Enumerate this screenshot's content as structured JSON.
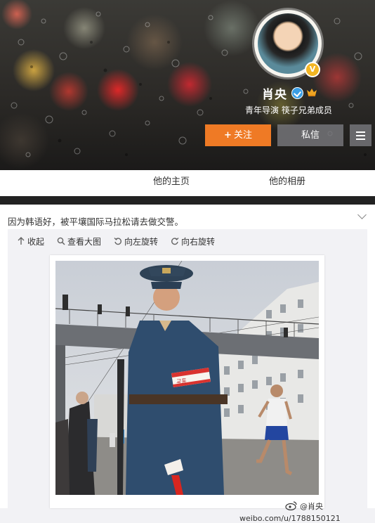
{
  "profile": {
    "name": "肖央",
    "description": "青年导演 筷子兄弟成员",
    "vip_badge": "V",
    "follow_label": "关注",
    "follow_plus": "+",
    "message_label": "私信"
  },
  "tabs": [
    {
      "label": "他的主页"
    },
    {
      "label": "他的相册"
    }
  ],
  "post": {
    "text": "因为韩语好，被平壤国际马拉松请去做交警。",
    "toolbar": {
      "collapse": "收起",
      "view_large": "查看大图",
      "rotate_left": "向左旋转",
      "rotate_right": "向右旋转"
    },
    "photo": {
      "armband_text": "교통",
      "watermark_url": "weibo.com/u/1788150121",
      "watermark_name": "@肖央"
    }
  },
  "colors": {
    "follow_button": "#ef7a25",
    "verify_blue": "#3a9ee6",
    "vip_gold": "#f3b624"
  },
  "icons": [
    "vip-icon",
    "verify-icon",
    "member-icon",
    "menu-icon",
    "expand-chevron-icon",
    "collapse-icon",
    "zoom-icon",
    "rotate-left-icon",
    "rotate-right-icon",
    "weibo-logo-icon"
  ]
}
